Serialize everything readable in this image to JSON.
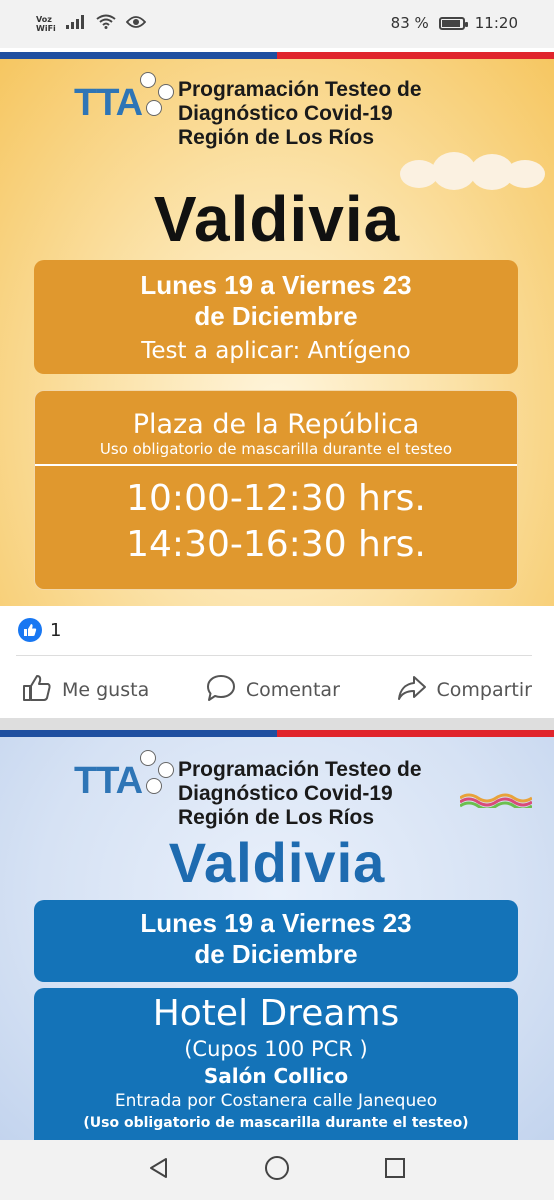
{
  "status_bar": {
    "carrier_line1": "Voz",
    "carrier_line2": "WiFi",
    "battery_percent": "83 %",
    "battery_level": 0.83,
    "time": "11:20"
  },
  "post1": {
    "logo_text": "TTA",
    "header_line1": "Programación Testeo de",
    "header_line2": "Diagnóstico Covid-19",
    "header_line3": "Región de Los Ríos",
    "city": "Valdivia",
    "dates_line1": "Lunes 19 a  Viernes 23",
    "dates_line2": "de Diciembre",
    "test_line": "Test a aplicar: Antígeno",
    "place_name": "Plaza de la República",
    "place_note": "Uso obligatorio de mascarilla durante el testeo",
    "hours_line1": "10:00-12:30 hrs.",
    "hours_line2": "14:30-16:30 hrs.",
    "colors": {
      "accent": "#e0982e",
      "title": "#111111"
    }
  },
  "reactions": {
    "like_count": "1"
  },
  "actions": {
    "like": "Me gusta",
    "comment": "Comentar",
    "share": "Compartir"
  },
  "post2": {
    "logo_text": "TTA",
    "header_line1": "Programación Testeo de",
    "header_line2": "Diagnóstico Covid-19",
    "header_line3": "Región de Los Ríos",
    "city": "Valdivia",
    "dates_line1": "Lunes 19 a  Viernes 23",
    "dates_line2": "de Diciembre",
    "place_name": "Hotel Dreams",
    "capacity": "(Cupos 100 PCR  )",
    "room": "Salón Collico",
    "entrance": "Entrada por Costanera calle Janequeo",
    "mask_note": "(Uso obligatorio de mascarilla durante el testeo)",
    "colors": {
      "accent": "#1473b8",
      "title": "#1e6bb0"
    }
  },
  "nav": {
    "icons": [
      "back-icon",
      "home-icon",
      "recents-icon"
    ]
  }
}
